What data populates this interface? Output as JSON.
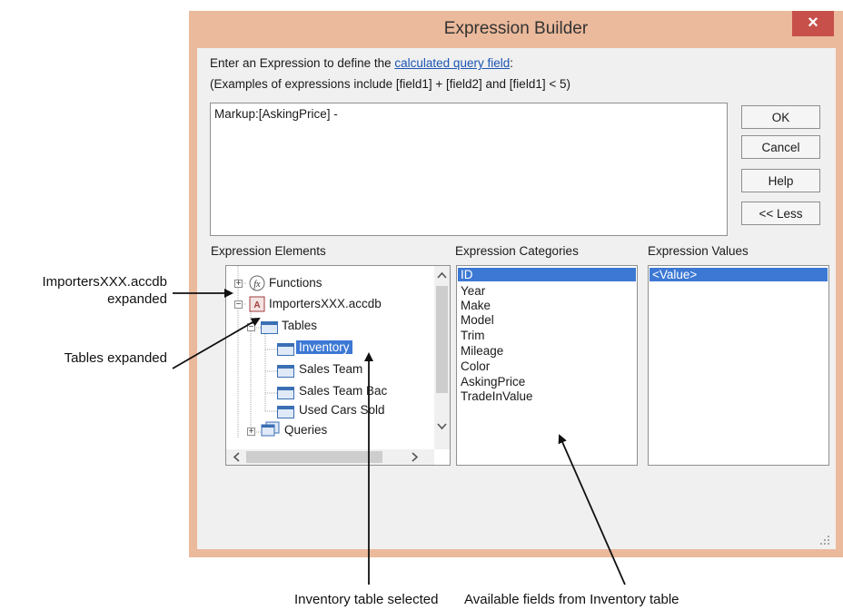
{
  "window": {
    "title": "Expression Builder",
    "close_symbol": "×"
  },
  "intro": {
    "line1_prefix": "Enter an Expression to define the ",
    "line1_link": "calculated query field",
    "line1_suffix": ":",
    "line2": "(Examples of expressions include [field1] + [field2] and [field1] < 5)"
  },
  "expression": {
    "value": "Markup:[AskingPrice] -"
  },
  "buttons": {
    "ok": "OK",
    "cancel": "Cancel",
    "help": "Help",
    "less": "<< Less"
  },
  "elements": {
    "label": "Expression Elements",
    "items": [
      "Functions",
      "ImportersXXX.accdb",
      "Tables",
      "Inventory",
      "Sales Team",
      "Sales Team Bac",
      "Used Cars Sold",
      "Queries"
    ]
  },
  "categories": {
    "label": "Expression Categories",
    "items": [
      "ID",
      "Year",
      "Make",
      "Model",
      "Trim",
      "Mileage",
      "Color",
      "AskingPrice",
      "TradeInValue"
    ]
  },
  "values": {
    "label": "Expression Values",
    "items": [
      "<Value>"
    ]
  },
  "annotations": {
    "db_expanded_1": "ImportersXXX.accdb",
    "db_expanded_2": "expanded",
    "tables_expanded": "Tables expanded",
    "inventory_selected": "Inventory table selected",
    "available_fields": "Available fields from Inventory table"
  },
  "icons": [
    "close-icon",
    "function-icon",
    "database-icon",
    "table-icon",
    "query-icon",
    "scroll-up-icon",
    "scroll-down-icon",
    "scroll-left-icon",
    "scroll-right-icon",
    "resize-grip-icon"
  ]
}
